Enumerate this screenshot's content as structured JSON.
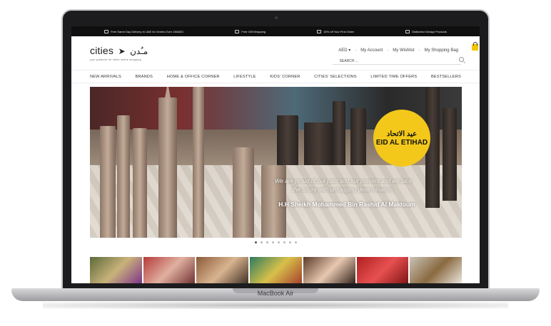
{
  "device": {
    "base_label": "MacBook Air"
  },
  "promo": [
    {
      "icon": "truck-icon",
      "text": "Free Same Day Delivery in UAE for Orders Over 150AED"
    },
    {
      "icon": "gift-icon",
      "text": "Free Gift Wrapping"
    },
    {
      "icon": "tag-icon",
      "text": "15% off Your First Order"
    },
    {
      "icon": "award-icon",
      "text": "Distinctive Design Products"
    }
  ],
  "logo": {
    "word": "cities",
    "arabic": "مـُدن",
    "tagline": "your platform for cities online shopping"
  },
  "account": {
    "currency": "AED",
    "my_account": "My Account",
    "wishlist": "My Wishlist",
    "bag": "My Shopping Bag"
  },
  "search": {
    "label": "SEARCH ..."
  },
  "nav": [
    "NEW ARRIVALS",
    "BRANDS",
    "HOME & OFFICE CORNER",
    "LIFESTYLE",
    "KIDS' CORNER",
    "CITIES' SELECTIONS",
    "LIMITED TIME OFFERS",
    "BESTSELLERS"
  ],
  "hero": {
    "badge_arabic": "عيد الاتحاد",
    "badge_text": "EID AL ETIHAD",
    "quote_line1": "We are proud of our past and our present and we face",
    "quote_line2": "the future with unflagging determination.",
    "author": "H.H Sheikh Mohammed Bin Rashid Al Maktoum"
  },
  "carousel": {
    "count": 8,
    "active": 0
  },
  "colors": {
    "accent": "#f3c81a",
    "promo_bg": "#0f0f0f"
  }
}
